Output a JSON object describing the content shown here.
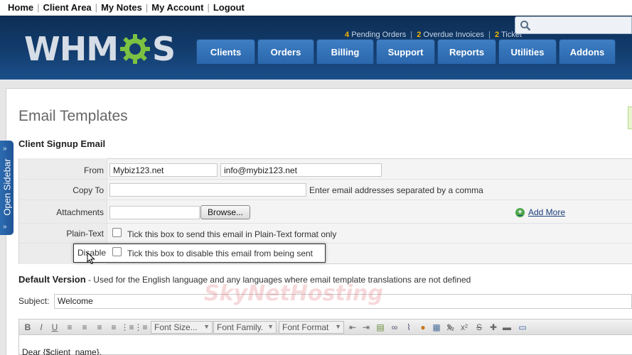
{
  "top_nav": {
    "items": [
      "Home",
      "Client Area",
      "My Notes",
      "My Account",
      "Logout"
    ],
    "separator": "|"
  },
  "header": {
    "logo_text_left": "WHM",
    "logo_text_right": "S",
    "stats": {
      "pending_count": "4",
      "pending_label": "Pending Orders",
      "overdue_count": "2",
      "overdue_label": "Overdue Invoices",
      "tickets_count": "2",
      "tickets_label": "Ticket",
      "sep": "|"
    },
    "search_icon": "search-icon",
    "tabs": [
      "Clients",
      "Orders",
      "Billing",
      "Support",
      "Reports",
      "Utilities",
      "Addons"
    ]
  },
  "sidebar": {
    "label": "Open Sidebar",
    "arrow": "»"
  },
  "page": {
    "title": "Email Templates",
    "section_title": "Client Signup Email"
  },
  "form": {
    "from_label": "From",
    "from_name": "Mybiz123.net",
    "from_email": "info@mybiz123.net",
    "copy_to_label": "Copy To",
    "copy_to_value": "",
    "copy_to_help": "Enter email addresses separated by a comma",
    "attachments_label": "Attachments",
    "browse_label": "Browse...",
    "add_more_label": "Add More",
    "plain_text_label": "Plain-Text",
    "plain_text_help": "Tick this box to send this email in Plain-Text format only",
    "disable_label": "Disable",
    "disable_help": "Tick this box to disable this email from being sent"
  },
  "default_version": {
    "title": "Default Version",
    "description": " - Used for the English language and any languages where email template translations are not defined"
  },
  "subject": {
    "label": "Subject:",
    "value": "Welcome"
  },
  "editor": {
    "font_size": "Font Size...",
    "font_family": "Font Family.",
    "font_format": "Font Format",
    "body_start": "Dear {$client_name},"
  },
  "watermark": "SkyNetHosting",
  "colors": {
    "header_dark": "#0d2e55",
    "tab_blue": "#2a67ad",
    "stat_accent": "#f4b400",
    "logo_gear_green": "#7cc242"
  }
}
